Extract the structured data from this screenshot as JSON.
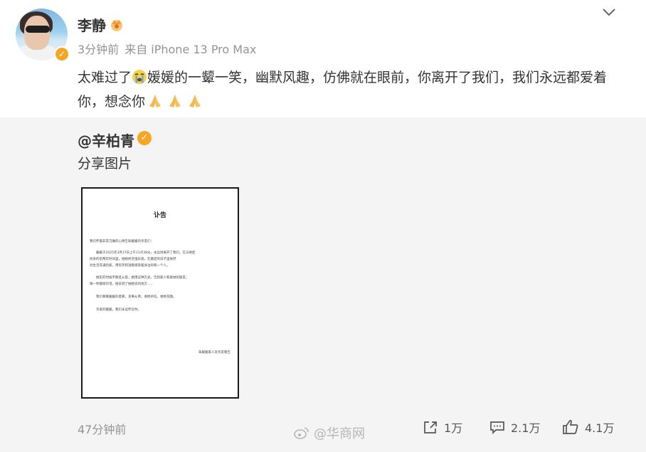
{
  "post": {
    "author": "李静",
    "time": "3分钟前",
    "source": "来自 iPhone 13 Pro Max",
    "text_before_emoji": "太难过了",
    "text_after_emoji": "媛媛的一颦一笑，幽默风趣，仿佛就在眼前，你离开了我们，我们永远都爱着你，想念你",
    "icons": {
      "crown": "crown-icon",
      "verified": "verified-icon",
      "more": "chevron-down-icon",
      "crying": "crying-emoji-icon",
      "pray": "pray-emoji-icon"
    }
  },
  "repost": {
    "author": "@辛柏青",
    "text": "分享图片",
    "image": {
      "title": "讣告",
      "lines": [
        "我们怀着非常沉痛的心情告知媛媛的亲友们：",
        "　　媛媛于2025年3月17日上午11点38分，永远地离开了我们。在与癌症",
        "抗争的近两年时间里，她始终坚强乐观，在最后的日子里依然",
        "对生活充满热爱，用欢笑和温暖感染着身边的每一个人。",
        "　　她走的时候平静且从容，她用这种方式，告别家人和爱她的朋友，",
        "每一秒都很珍惜，她去到了她想去的地方……",
        "　　我们尊重媛媛的意愿，丧事从简，谢绝吊唁，谢绝花圈。",
        "　　亲爱的媛媛，我们永远怀念你。"
      ],
      "signature": "朱媛媛家人及亲友敬告"
    }
  },
  "footer": {
    "time": "47分钟前",
    "repost_count": "1万",
    "comment_count": "2.1万",
    "like_count": "4.1万",
    "watermark": "@华商网"
  },
  "colors": {
    "meta_gray": "#939393",
    "repost_bg": "#f4f4f4",
    "badge_orange": "#f5a623"
  }
}
